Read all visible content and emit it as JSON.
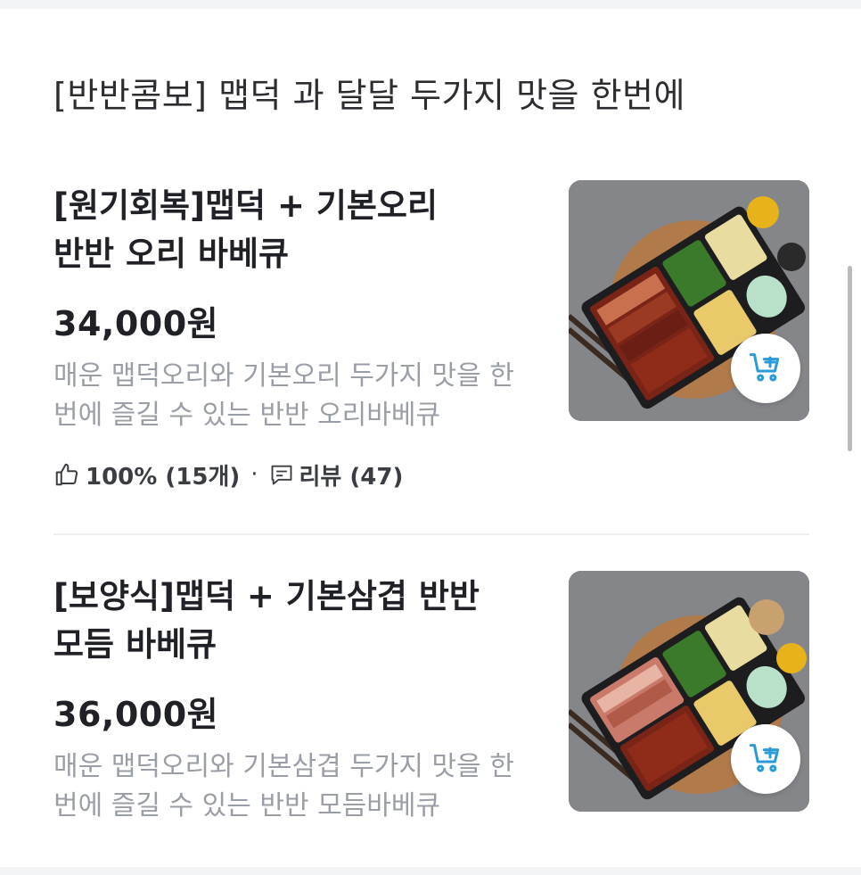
{
  "section": {
    "title": "[반반콤보] 맵덕 과 달달 두가지 맛을 한번에"
  },
  "products": [
    {
      "name": " [원기회복]맵덕 + 기본오리\n반반 오리 바베큐",
      "price": "34,000원",
      "description": "매운 맵덕오리와 기본오리 두가지 맛을 한번에 즐길 수 있는 반반 오리바베큐",
      "rating": "100% (15개)",
      "separator": "·",
      "reviews": "리뷰 (47)",
      "image_icon": "duck-bbq-box-photo",
      "cart_icon": "add-to-cart-icon"
    },
    {
      "name": "[보양식]맵덕 + 기본삼겹 반반\n모듬 바베큐",
      "price": "36,000원",
      "description": "매운 맵덕오리와 기본삼겹 두가지 맛을 한번에 즐길 수 있는 반반 모듬바베큐",
      "image_icon": "pork-duck-bbq-box-photo",
      "cart_icon": "add-to-cart-icon"
    }
  ],
  "colors": {
    "accent": "#2a9ad8",
    "price_text": "#1f2126",
    "desc_text": "#9a9ea6"
  }
}
